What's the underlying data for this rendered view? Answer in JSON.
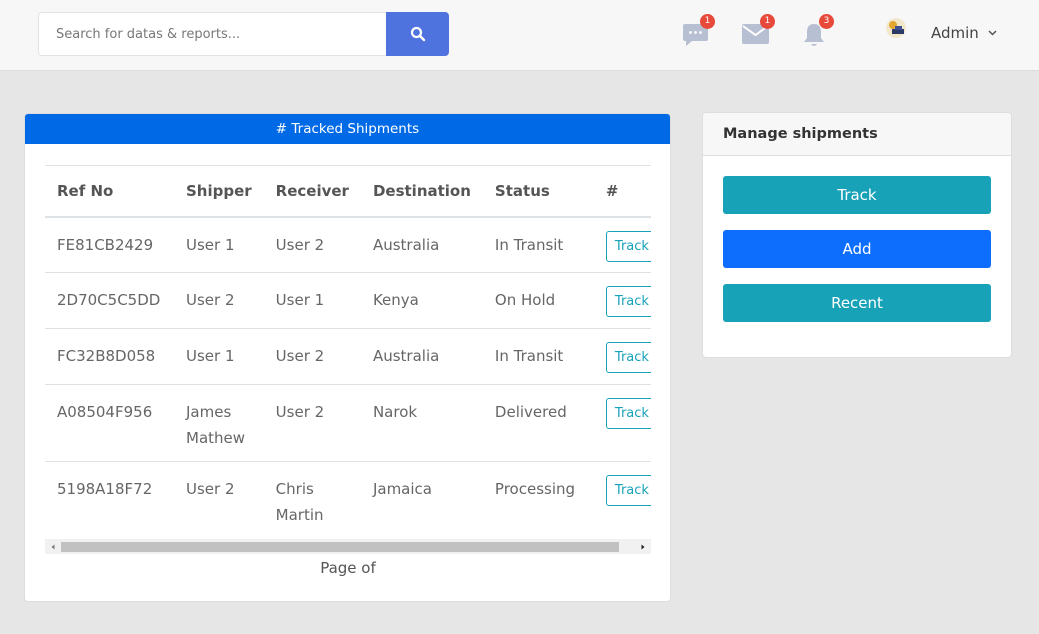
{
  "search": {
    "placeholder": "Search for datas & reports..."
  },
  "topbar": {
    "messages_badge": "1",
    "mail_badge": "1",
    "alerts_badge": "3",
    "user_name": "Admin"
  },
  "shipments": {
    "header": "# Tracked Shipments",
    "columns": [
      "Ref No",
      "Shipper",
      "Receiver",
      "Destination",
      "Status",
      "#"
    ],
    "rows": [
      {
        "ref": "FE81CB2429",
        "shipper": "User 1",
        "receiver": "User 2",
        "destination": "Australia",
        "status": "In Transit",
        "action": "Track"
      },
      {
        "ref": "2D70C5C5DD",
        "shipper": "User 2",
        "receiver": "User 1",
        "destination": "Kenya",
        "status": "On Hold",
        "action": "Track"
      },
      {
        "ref": "FC32B8D058",
        "shipper": "User 1",
        "receiver": "User 2",
        "destination": "Australia",
        "status": "In Transit",
        "action": "Track"
      },
      {
        "ref": "A08504F956",
        "shipper": "James Mathew",
        "receiver": "User 2",
        "destination": "Narok",
        "status": "Delivered",
        "action": "Track"
      },
      {
        "ref": "5198A18F72",
        "shipper": "User 2",
        "receiver": "Chris Martin",
        "destination": "Jamaica",
        "status": "Processing",
        "action": "Track"
      }
    ],
    "page_label": "Page of"
  },
  "manage": {
    "title": "Manage shipments",
    "track_label": "Track",
    "add_label": "Add",
    "recent_label": "Recent"
  },
  "colors": {
    "primary": "#006ae6",
    "search_button": "#4e73df",
    "info": "#17a2b8",
    "add_button": "#0d6efd",
    "badge": "#e74a3b"
  }
}
